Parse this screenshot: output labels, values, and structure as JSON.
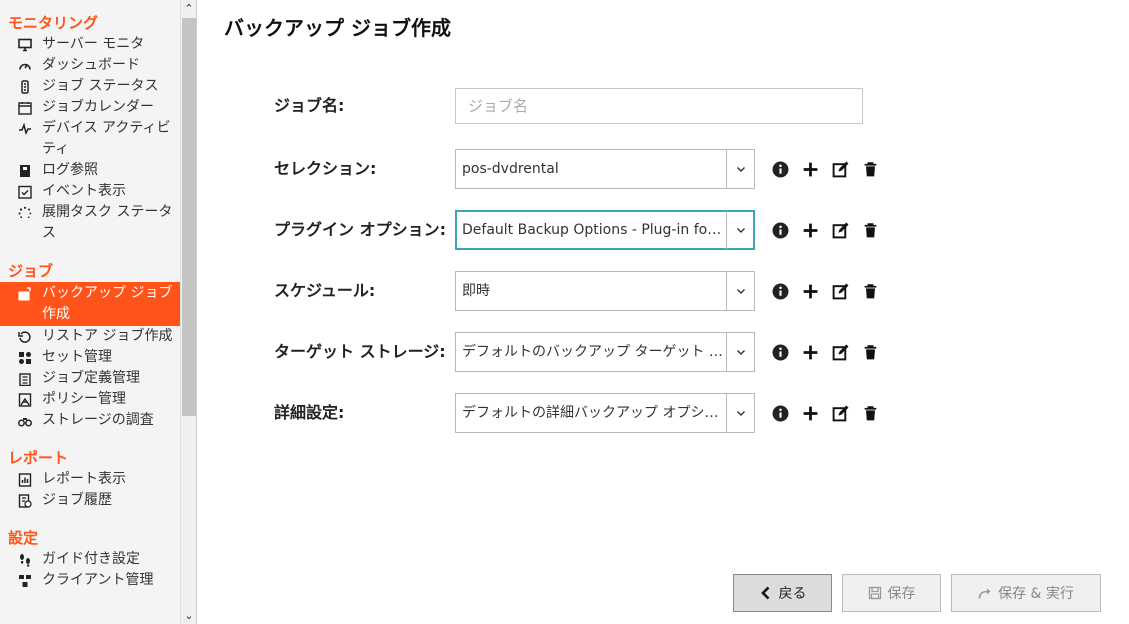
{
  "sidebar": {
    "sections": [
      {
        "heading": "モニタリング",
        "items": [
          {
            "label": "サーバー モニタ",
            "icon": "monitor-icon"
          },
          {
            "label": "ダッシュボード",
            "icon": "gauge-icon"
          },
          {
            "label": "ジョブ ステータス",
            "icon": "traffic-light-icon"
          },
          {
            "label": "ジョブカレンダー",
            "icon": "calendar-icon"
          },
          {
            "label": "デバイス アクティビティ",
            "icon": "activity-icon"
          },
          {
            "label": "ログ参照",
            "icon": "log-book-icon"
          },
          {
            "label": "イベント表示",
            "icon": "event-check-icon"
          },
          {
            "label": "展開タスク ステータス",
            "icon": "spinner-icon"
          }
        ]
      },
      {
        "heading": "ジョブ",
        "items": [
          {
            "label": "バックアップ ジョブ作成",
            "icon": "backup-job-icon",
            "active": true
          },
          {
            "label": "リストア ジョブ作成",
            "icon": "restore-icon"
          },
          {
            "label": "セット管理",
            "icon": "sets-icon"
          },
          {
            "label": "ジョブ定義管理",
            "icon": "clipboard-icon"
          },
          {
            "label": "ポリシー管理",
            "icon": "policy-icon"
          },
          {
            "label": "ストレージの調査",
            "icon": "binoculars-icon"
          }
        ]
      },
      {
        "heading": "レポート",
        "items": [
          {
            "label": "レポート表示",
            "icon": "report-icon"
          },
          {
            "label": "ジョブ履歴",
            "icon": "history-icon"
          }
        ]
      },
      {
        "heading": "設定",
        "items": [
          {
            "label": "ガイド付き設定",
            "icon": "footsteps-icon"
          },
          {
            "label": "クライアント管理",
            "icon": "clients-icon"
          }
        ]
      }
    ],
    "scroll_up": "⌃",
    "scroll_down": "⌄"
  },
  "page": {
    "title": "バックアップ ジョブ作成"
  },
  "form": {
    "job_name": {
      "label": "ジョブ名:",
      "value": "",
      "placeholder": "ジョブ名"
    },
    "selection": {
      "label": "セレクション:",
      "value": "pos-dvdrental"
    },
    "plugin_options": {
      "label": "プラグイン オプション:",
      "value": "Default Backup Options - Plug-in for…"
    },
    "schedule": {
      "label": "スケジュール:",
      "value": "即時"
    },
    "target_storage": {
      "label": "ターゲット ストレージ:",
      "value": "デフォルトのバックアップ ターゲット …"
    },
    "advanced": {
      "label": "詳細設定:",
      "value": "デフォルトの詳細バックアップ オプシ…"
    }
  },
  "buttons": {
    "back": "戻る",
    "save": "保存",
    "save_run": "保存 & 実行"
  },
  "colors": {
    "accent": "#ff5319",
    "focus": "#39a6b8"
  }
}
